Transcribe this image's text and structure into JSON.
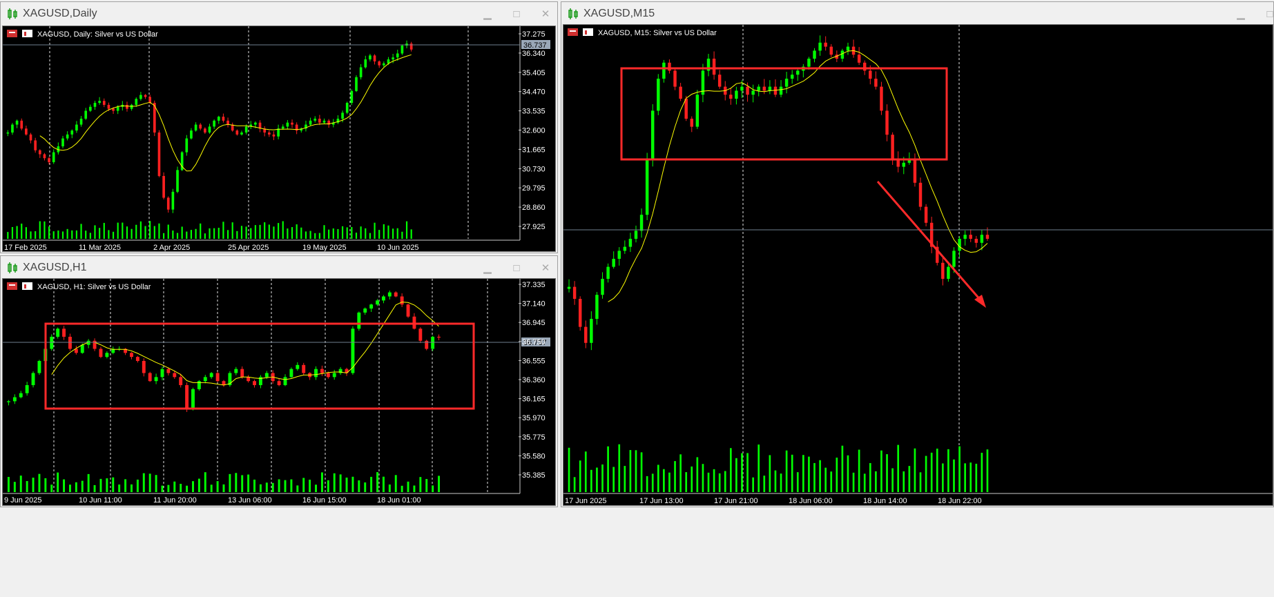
{
  "windows": {
    "daily": {
      "title": "XAGUSD,Daily",
      "chart_label": "XAGUSD, Daily:  Silver vs US Dollar",
      "price_label": "36.737"
    },
    "h1": {
      "title": "XAGUSD,H1",
      "chart_label": "XAGUSD, H1:  Silver vs US Dollar",
      "price_label": "36.737"
    },
    "m15": {
      "title": "XAGUSD,M15",
      "chart_label": "XAGUSD, M15:  Silver vs US Dollar"
    }
  },
  "colors": {
    "bull": "#00ff00",
    "bear": "#ff2020",
    "ma": "#ffff00",
    "grid": "#ffffff",
    "annotation": "#ff2a2a",
    "price_line": "#708090"
  },
  "icons": [
    "chart-window-icon",
    "minimize-icon",
    "maximize-icon",
    "close-icon",
    "chart-properties-icon"
  ],
  "chart_data": [
    {
      "type": "candlestick",
      "symbol": "XAGUSD",
      "timeframe": "Daily",
      "y_ticks": [
        "37.275",
        "36.340",
        "35.405",
        "34.470",
        "33.535",
        "32.600",
        "31.665",
        "30.730",
        "29.795",
        "28.860",
        "27.925"
      ],
      "x_ticks": [
        "17 Feb 2025",
        "11 Mar 2025",
        "2 Apr 2025",
        "25 Apr 2025",
        "19 May 2025",
        "10 Jun 2025"
      ],
      "ylim": [
        27.4,
        37.6
      ],
      "series": [
        {
          "values": [
            32.5,
            32.9,
            33.1,
            32.7,
            32.4,
            32.1,
            31.6,
            31.4,
            31.2,
            31.0,
            31.5,
            31.8,
            32.2,
            32.4,
            32.6,
            32.9,
            33.2,
            33.6,
            33.8,
            34.0,
            34.1,
            33.9,
            33.7,
            33.6,
            33.8,
            33.9,
            33.7,
            33.9,
            34.2,
            34.4,
            34.3,
            34.0,
            32.5,
            30.3,
            29.2,
            28.6,
            29.5,
            30.6,
            31.5,
            32.2,
            32.6,
            32.9,
            32.7,
            32.5,
            32.8,
            33.1,
            33.3,
            33.1,
            32.9,
            32.6,
            32.4,
            32.5,
            32.8,
            32.9,
            33.0,
            32.7,
            32.5,
            32.4,
            32.3,
            32.7,
            32.8,
            33.0,
            32.9,
            32.6,
            32.7,
            32.9,
            33.1,
            33.2,
            33.0,
            33.1,
            32.9,
            33.0,
            33.2,
            33.5,
            34.0,
            34.6,
            35.3,
            35.8,
            36.2,
            36.4,
            36.1,
            35.9,
            36.0,
            36.2,
            36.3,
            36.5,
            36.9,
            37.0,
            36.7
          ]
        }
      ]
    },
    {
      "type": "candlestick",
      "symbol": "XAGUSD",
      "timeframe": "H1",
      "y_ticks": [
        "37.335",
        "37.140",
        "36.945",
        "36.750",
        "36.555",
        "36.360",
        "36.165",
        "35.970",
        "35.775",
        "35.580",
        "35.385"
      ],
      "x_ticks": [
        "9 Jun 2025",
        "10 Jun 11:00",
        "11 Jun 20:00",
        "13 Jun 06:00",
        "16 Jun 15:00",
        "18 Jun 01:00"
      ],
      "ylim": [
        35.2,
        37.4
      ],
      "series": [
        {
          "values": [
            35.95,
            36.0,
            36.05,
            36.15,
            36.3,
            36.45,
            36.6,
            36.75,
            36.85,
            36.75,
            36.6,
            36.55,
            36.65,
            36.7,
            36.6,
            36.5,
            36.55,
            36.6,
            36.6,
            36.55,
            36.5,
            36.45,
            36.3,
            36.2,
            36.25,
            36.35,
            36.3,
            36.25,
            36.15,
            35.85,
            36.1,
            36.2,
            36.25,
            36.3,
            36.2,
            36.15,
            36.3,
            36.35,
            36.25,
            36.2,
            36.15,
            36.25,
            36.3,
            36.2,
            36.15,
            36.25,
            36.35,
            36.4,
            36.3,
            36.25,
            36.35,
            36.3,
            36.25,
            36.3,
            36.35,
            36.3,
            36.85,
            37.05,
            37.1,
            37.15,
            37.2,
            37.25,
            37.3,
            37.25,
            37.15,
            37.0,
            36.85,
            36.7,
            36.6,
            36.75,
            36.74
          ]
        }
      ]
    },
    {
      "type": "candlestick",
      "symbol": "XAGUSD",
      "timeframe": "M15",
      "y_ticks": [],
      "x_ticks": [
        "17 Jun 2025",
        "17 Jun 13:00",
        "17 Jun 21:00",
        "18 Jun 06:00",
        "18 Jun 14:00",
        "18 Jun 22:00"
      ],
      "ylim": [
        0,
        100
      ],
      "series": [
        {
          "values": [
            38,
            35,
            28,
            24,
            30,
            36,
            40,
            43,
            45,
            47,
            48,
            50,
            52,
            56,
            70,
            82,
            90,
            94,
            92,
            88,
            85,
            80,
            78,
            86,
            92,
            95,
            91,
            88,
            86,
            85,
            87,
            88,
            86,
            87,
            88,
            87,
            88,
            86,
            88,
            90,
            91,
            92,
            93,
            95,
            97,
            99,
            98,
            96,
            95,
            97,
            98,
            96,
            94,
            92,
            90,
            88,
            82,
            76,
            70,
            68,
            69,
            70,
            64,
            58,
            54,
            48,
            44,
            40,
            43,
            47,
            50,
            51,
            50,
            49,
            51,
            50
          ]
        }
      ]
    }
  ]
}
